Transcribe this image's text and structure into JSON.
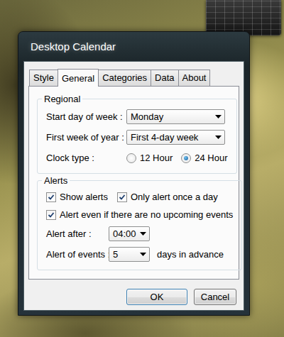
{
  "window": {
    "title": "Desktop Calendar"
  },
  "tabs": [
    {
      "label": "Style",
      "selected": false
    },
    {
      "label": "General",
      "selected": true
    },
    {
      "label": "Categories",
      "selected": false
    },
    {
      "label": "Data",
      "selected": false
    },
    {
      "label": "About",
      "selected": false
    }
  ],
  "regional": {
    "title": "Regional",
    "fields": [
      {
        "label": "Start day of week :",
        "value": "Monday"
      },
      {
        "label": "First week of year :",
        "value": "First 4-day week"
      }
    ],
    "clock": {
      "label": "Clock type :",
      "options": [
        {
          "label": "12 Hour",
          "selected": false
        },
        {
          "label": "24 Hour",
          "selected": true
        }
      ]
    }
  },
  "alerts": {
    "title": "Alerts",
    "checkbox_rows": [
      [
        {
          "label": "Show alerts",
          "checked": true
        },
        {
          "label": "Only alert once a day",
          "checked": true
        }
      ],
      [
        {
          "label": "Alert even if there are no upcoming events",
          "checked": true
        }
      ]
    ],
    "alert_after": {
      "label": "Alert after :",
      "value": "04:00"
    },
    "advance": {
      "label": "Alert of events :",
      "value": "5",
      "suffix": "days in advance"
    }
  },
  "buttons": [
    {
      "label": "OK",
      "default": true
    },
    {
      "label": "Cancel",
      "default": false
    }
  ]
}
